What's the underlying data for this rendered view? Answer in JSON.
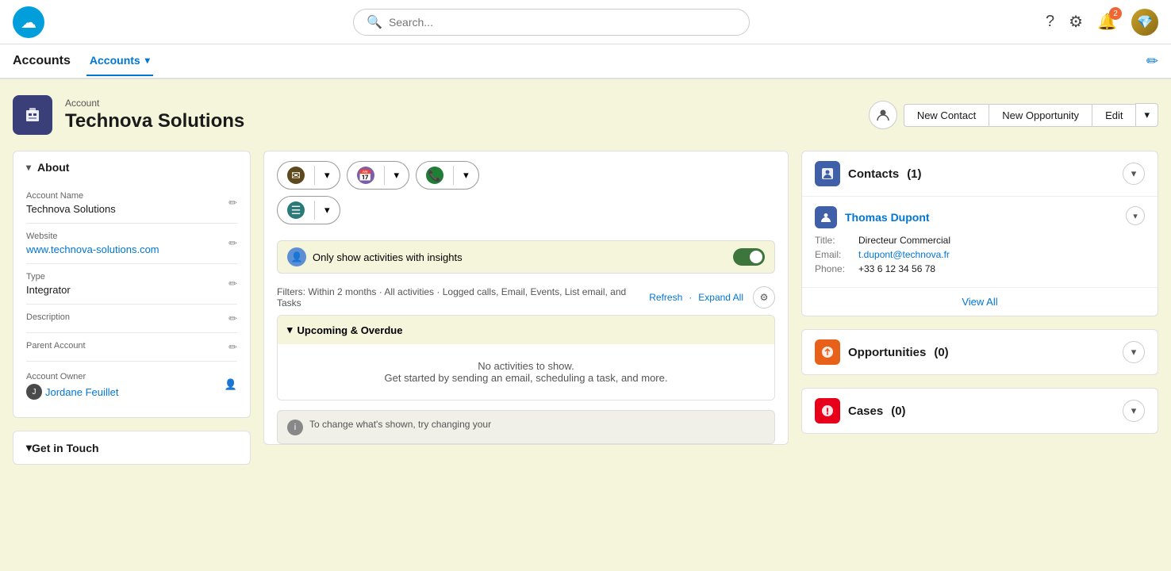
{
  "app": {
    "logo_text": "☁",
    "search_placeholder": "Search...",
    "nav_icons": {
      "help": "?",
      "settings": "⚙",
      "notifications": "🔔",
      "notification_count": "2"
    }
  },
  "subnav": {
    "title": "Accounts",
    "tab_label": "Accounts",
    "edit_icon": "✏"
  },
  "record": {
    "label": "Account",
    "title": "Technova Solutions",
    "actions": {
      "new_contact": "New Contact",
      "new_opportunity": "New Opportunity",
      "edit": "Edit"
    }
  },
  "about": {
    "header": "About",
    "fields": {
      "account_name_label": "Account Name",
      "account_name_value": "Technova Solutions",
      "website_label": "Website",
      "website_value": "www.technova-solutions.com",
      "type_label": "Type",
      "type_value": "Integrator",
      "description_label": "Description",
      "description_value": "",
      "parent_account_label": "Parent Account",
      "parent_account_value": "",
      "account_owner_label": "Account Owner",
      "account_owner_value": "Jordane Feuillet"
    }
  },
  "get_in_touch": {
    "header": "Get in Touch"
  },
  "activity": {
    "buttons": {
      "email": "✉",
      "calendar": "📅",
      "phone": "📞",
      "list": "☰"
    },
    "insights": {
      "icon": "👤",
      "label": "Only show activities with insights"
    },
    "filters": {
      "text": "Filters: Within 2 months · All activities · Logged calls, Email, Events, List email, and Tasks",
      "refresh": "Refresh",
      "expand_all": "Expand All"
    },
    "upcoming": {
      "header": "Upcoming & Overdue",
      "empty_message": "No activities to show.",
      "empty_sub": "Get started by sending an email, scheduling a task, and more."
    },
    "tip": "To change what's shown, try changing your"
  },
  "contacts": {
    "header": "Contacts",
    "count": "(1)",
    "contact": {
      "name": "Thomas Dupont",
      "title_label": "Title:",
      "title_value": "Directeur Commercial",
      "email_label": "Email:",
      "email_value": "t.dupont@technova.fr",
      "phone_label": "Phone:",
      "phone_value": "+33 6 12 34 56 78"
    },
    "view_all": "View All"
  },
  "opportunities": {
    "header": "Opportunities",
    "count": "(0)"
  },
  "cases": {
    "header": "Cases",
    "count": "(0)"
  }
}
